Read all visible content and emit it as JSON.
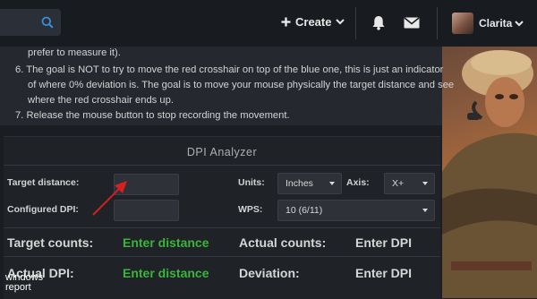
{
  "navbar": {
    "create_label": "Create",
    "username": "Clarita"
  },
  "instructions": {
    "lines": [
      "prefer to measure it).",
      "6. The goal is NOT to try to move the red crosshair on top of the blue one, this is just an indicator",
      "of where 0% deviation is. The goal is to move your mouse physically the target distance and see",
      "where the red crosshair ends up.",
      "7. Release the mouse button to stop recording the movement."
    ]
  },
  "dpi_analyzer": {
    "title": "DPI Analyzer",
    "target_distance_label": "Target distance:",
    "target_distance_value": "",
    "configured_dpi_label": "Configured DPI:",
    "configured_dpi_value": "",
    "units_label": "Units:",
    "units_value": "Inches",
    "axis_label": "Axis:",
    "axis_value": "X+",
    "wps_label": "WPS:",
    "wps_value": "10 (6/11)",
    "target_counts_label": "Target counts:",
    "target_counts_value": "Enter distance",
    "actual_counts_label": "Actual counts:",
    "actual_counts_value": "Enter DPI",
    "actual_dpi_label": "Actual DPI:",
    "actual_dpi_value": "Enter distance",
    "deviation_label": "Deviation:",
    "deviation_value": "Enter DPI"
  },
  "watermark": {
    "line1": "windows",
    "line2": "report"
  },
  "colors": {
    "accent_blue": "#3a8fd8",
    "value_green": "#3cb43c",
    "arrow_red": "#d42020"
  },
  "icons": [
    "search-icon",
    "plus-icon",
    "chevron-down-icon",
    "bell-icon",
    "mail-icon"
  ]
}
